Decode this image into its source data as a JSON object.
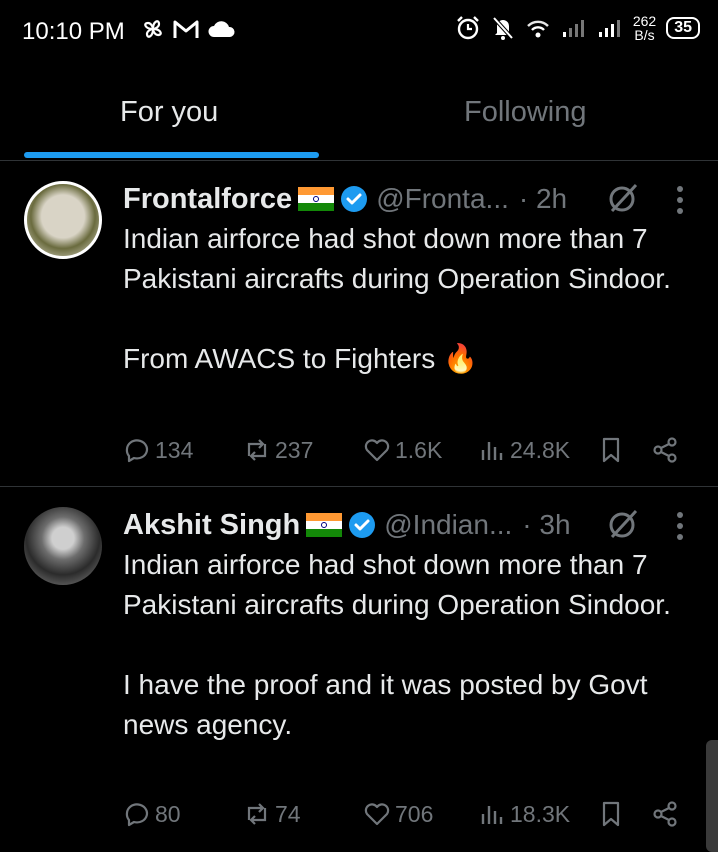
{
  "status_bar": {
    "time": "10:10 PM",
    "speed_value": "262",
    "speed_unit": "B/s",
    "battery": "35",
    "left_icons": [
      "pinwheel-icon",
      "gmail-icon",
      "cloud-icon"
    ],
    "right_icons": [
      "alarm-icon",
      "mute-icon",
      "wifi-icon",
      "signal-icon",
      "signal-icon"
    ]
  },
  "tabs": [
    {
      "label": "For you",
      "active": true
    },
    {
      "label": "Following",
      "active": false
    }
  ],
  "colors": {
    "accent": "#1d9bf0",
    "muted": "#71767b",
    "text": "#e7e9ea",
    "background": "#000000"
  },
  "posts": [
    {
      "name": "Frontalforce",
      "handle": "@Fronta...",
      "time": "· 2h",
      "text": "Indian airforce had shot down more than 7 Pakistani aircrafts during Operation Sindoor.\n\nFrom AWACS to Fighters 🔥",
      "replies": "134",
      "reposts": "237",
      "likes": "1.6K",
      "views": "24.8K"
    },
    {
      "name": "Akshit Singh",
      "handle": "@Indian...",
      "time": "· 3h",
      "text": "Indian airforce had shot down more than 7 Pakistani aircrafts during Operation Sindoor.\n\nI have the proof and it was posted by Govt news agency.",
      "replies": "80",
      "reposts": "74",
      "likes": "706",
      "views": "18.3K"
    }
  ]
}
